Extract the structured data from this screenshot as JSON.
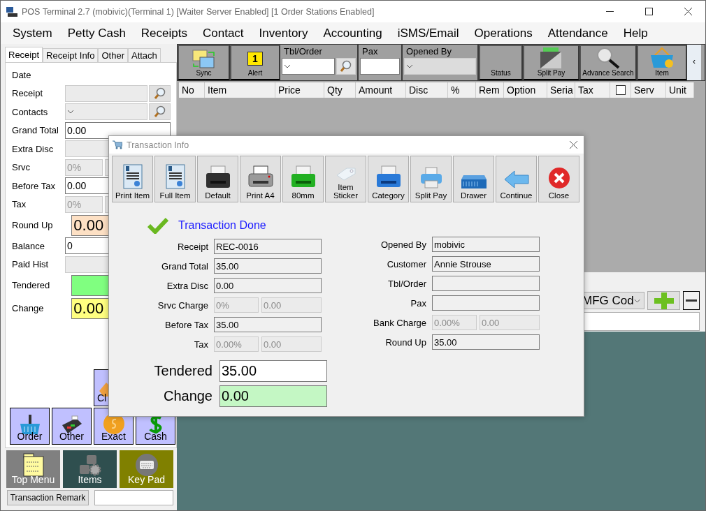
{
  "window": {
    "title": "POS Terminal 2.7 (mobivic)(Terminal 1) [Waiter Server Enabled] [1 Order Stations Enabled]"
  },
  "menu": [
    "System",
    "Petty Cash",
    "Receipts",
    "Contact",
    "Inventory",
    "Accounting",
    "iSMS/Email",
    "Operations",
    "Attendance",
    "Help"
  ],
  "left_tabs": [
    {
      "label": "Receipt",
      "selected": true
    },
    {
      "label": "Receipt Info",
      "selected": false
    },
    {
      "label": "Other",
      "selected": false
    },
    {
      "label": "Attach",
      "selected": false
    }
  ],
  "left_fields": [
    {
      "label": "Date",
      "kind": "label"
    },
    {
      "label": "Receipt",
      "kind": "lookup",
      "disabled": true
    },
    {
      "label": "Contacts",
      "kind": "combo_lookup",
      "disabled": true
    },
    {
      "label": "Grand Total",
      "kind": "text",
      "value": "0.00",
      "disabled": false
    },
    {
      "label": "Extra Disc",
      "kind": "text",
      "disabled": true
    },
    {
      "label": "Srvc",
      "kind": "split",
      "value": "0%",
      "disabled": true
    },
    {
      "label": "Before Tax",
      "kind": "text",
      "value": "0.00",
      "disabled": false
    },
    {
      "label": "Tax",
      "kind": "split",
      "value": "0%",
      "disabled": true
    },
    {
      "label": "Round Up",
      "kind": "big",
      "value": "0.00",
      "color": "#fde0c4"
    },
    {
      "label": "Balance",
      "kind": "text",
      "value": "0",
      "disabled": false
    },
    {
      "label": "Paid Hist",
      "kind": "text",
      "disabled": true
    },
    {
      "label": "Tendered",
      "kind": "big",
      "color": "#80ff80"
    },
    {
      "label": "Change",
      "kind": "big",
      "value": "0.00",
      "color": "#ffff80"
    }
  ],
  "upper_buttons": [
    {
      "label": "Cl",
      "kind": "clear"
    }
  ],
  "lower_buttons": [
    {
      "label": "Order",
      "kind": "order"
    },
    {
      "label": "Other",
      "kind": "other"
    },
    {
      "label": "Exact",
      "kind": "exact"
    },
    {
      "label": "Cash",
      "kind": "cash"
    }
  ],
  "tiles": [
    {
      "label": "Top Menu",
      "kind": "menu",
      "color": "#808080"
    },
    {
      "label": "Items",
      "kind": "items",
      "color": "#2f4f4f"
    },
    {
      "label": "Key Pad",
      "kind": "keypad",
      "color": "#808000"
    }
  ],
  "remark": {
    "button": "Transaction Remark"
  },
  "toolbar": [
    {
      "kind": "sync",
      "label": "Sync"
    },
    {
      "kind": "alert",
      "label": "Alert",
      "badge": "1"
    },
    {
      "kind": "combo",
      "label": "Tbl/Order",
      "lookup": true
    },
    {
      "kind": "input",
      "label": "Pax"
    },
    {
      "kind": "combo",
      "label": "Opened By",
      "lookup": false
    },
    {
      "kind": "status",
      "label": "Status"
    },
    {
      "kind": "wallet",
      "label": "Split Pay"
    },
    {
      "kind": "search",
      "label": "Advance Search"
    },
    {
      "kind": "basket",
      "label": "Item"
    },
    {
      "kind": "scroll",
      "label": "‹"
    }
  ],
  "table": {
    "columns": [
      {
        "label": "No",
        "kind": "text"
      },
      {
        "label": "Item",
        "kind": "text"
      },
      {
        "label": "Price",
        "kind": "text"
      },
      {
        "label": "Qty",
        "kind": "text"
      },
      {
        "label": "Amount",
        "kind": "text"
      },
      {
        "label": "Disc",
        "kind": "text"
      },
      {
        "label": "%",
        "kind": "text"
      },
      {
        "label": "Rem",
        "kind": "text"
      },
      {
        "label": "Option",
        "kind": "text"
      },
      {
        "label": "Seria",
        "kind": "text"
      },
      {
        "label": "Tax",
        "kind": "text"
      },
      {
        "kind": "checkbox",
        "checked": false
      },
      {
        "label": "Serv",
        "kind": "text"
      },
      {
        "label": "Unit",
        "kind": "text"
      }
    ]
  },
  "entry_panel": {
    "combo": "MFG Cod"
  },
  "dialog": {
    "title": "Transaction Info",
    "buttons": [
      {
        "label": "Print Item",
        "kind": "receipt"
      },
      {
        "label": "Full Item",
        "kind": "receipt"
      },
      {
        "label": "Default",
        "kind": "printer_black"
      },
      {
        "label": "Print A4",
        "kind": "printer_a4"
      },
      {
        "label": "80mm",
        "kind": "printer_green"
      },
      {
        "label": "Item Sticker",
        "kind": "tag"
      },
      {
        "label": "Category",
        "kind": "printer_blue"
      },
      {
        "label": "Split Pay",
        "kind": "printer_small"
      },
      {
        "label": "Drawer",
        "kind": "drawer"
      },
      {
        "label": "Continue",
        "kind": "arrow"
      },
      {
        "label": "Close",
        "kind": "close"
      }
    ],
    "status": "Transaction Done",
    "left_fields": [
      {
        "label": "Receipt",
        "values": [
          "REC-0016"
        ],
        "kind": "single",
        "disabled": false
      },
      {
        "label": "Grand Total",
        "values": [
          "35.00"
        ],
        "kind": "single",
        "disabled": false
      },
      {
        "label": "Extra Disc",
        "values": [
          "0.00"
        ],
        "kind": "single",
        "disabled": false
      },
      {
        "label": "Srvc Charge",
        "values": [
          "0%",
          "0.00"
        ],
        "kind": "split",
        "disabled": true
      },
      {
        "label": "Before Tax",
        "values": [
          "35.00"
        ],
        "kind": "single",
        "disabled": false
      },
      {
        "label": "Tax",
        "values": [
          "0.00%",
          "0.00"
        ],
        "kind": "split",
        "disabled": true
      }
    ],
    "right_fields": [
      {
        "label": "Opened By",
        "values": [
          "mobivic"
        ],
        "kind": "single",
        "disabled": false
      },
      {
        "label": "Customer",
        "values": [
          "Annie Strouse"
        ],
        "kind": "single",
        "disabled": false
      },
      {
        "label": "Tbl/Order",
        "kind": "single",
        "disabled": false
      },
      {
        "label": "Pax",
        "kind": "single",
        "disabled": false
      },
      {
        "label": "Bank Charge",
        "values": [
          "0.00%",
          "0.00"
        ],
        "kind": "split",
        "disabled": true
      },
      {
        "label": "Round Up",
        "values": [
          "35.00"
        ],
        "kind": "single",
        "disabled": false
      }
    ],
    "big_fields": [
      {
        "label": "Tendered",
        "value": "35.00",
        "color": "#ffffff"
      },
      {
        "label": "Change",
        "value": "0.00",
        "color": "#c4f7c4"
      }
    ]
  }
}
